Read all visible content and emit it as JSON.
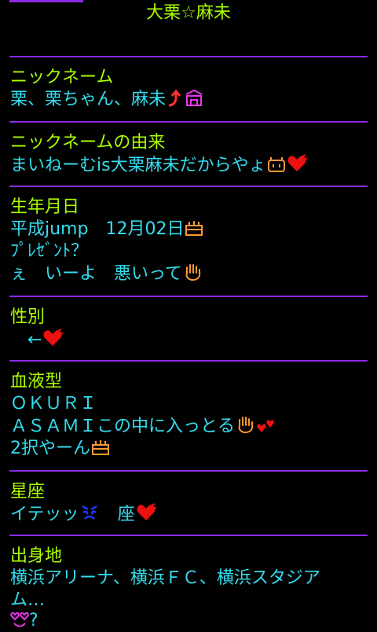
{
  "header": {
    "title": "大栗☆麻未"
  },
  "profile": {
    "nickname": {
      "label": "ニックネーム",
      "value": "栗、栗ちゃん、麻未"
    },
    "nickname_origin": {
      "label": "ニックネームの由来",
      "value": "まいねーむis大栗麻未だからやょ"
    },
    "birthday": {
      "label": "生年月日",
      "line1": "平成jump　12月02日",
      "line2": "ﾌﾟﾚｾﾞﾝﾄ？",
      "line3": "ぇ　いーよ　悪いって"
    },
    "gender": {
      "label": "性別",
      "value": "←"
    },
    "blood_type": {
      "label": "血液型",
      "line1": "ＯＫＵＲＩ",
      "line2": "ＡＳＡＭＩこの中に入っとる",
      "line3": "2択やーん"
    },
    "zodiac": {
      "label": "星座",
      "value_a": "イテッッ",
      "value_b": "座"
    },
    "birthplace": {
      "label": "出身地",
      "line1": "横浜アリーナ、横浜ＦＣ、横浜スタジア",
      "line2": "ム…",
      "line3": "?"
    }
  },
  "colors": {
    "heading": "#aaff00",
    "text": "#33ddee",
    "divider": "#8a2be2",
    "background": "#000000"
  },
  "icons": [
    "up-arrow-icon",
    "tent-icon",
    "face-icon",
    "heart-icon",
    "cake-icon",
    "hand-icon",
    "heart-small-icon",
    "angry-face-icon",
    "double-heart-icon"
  ]
}
